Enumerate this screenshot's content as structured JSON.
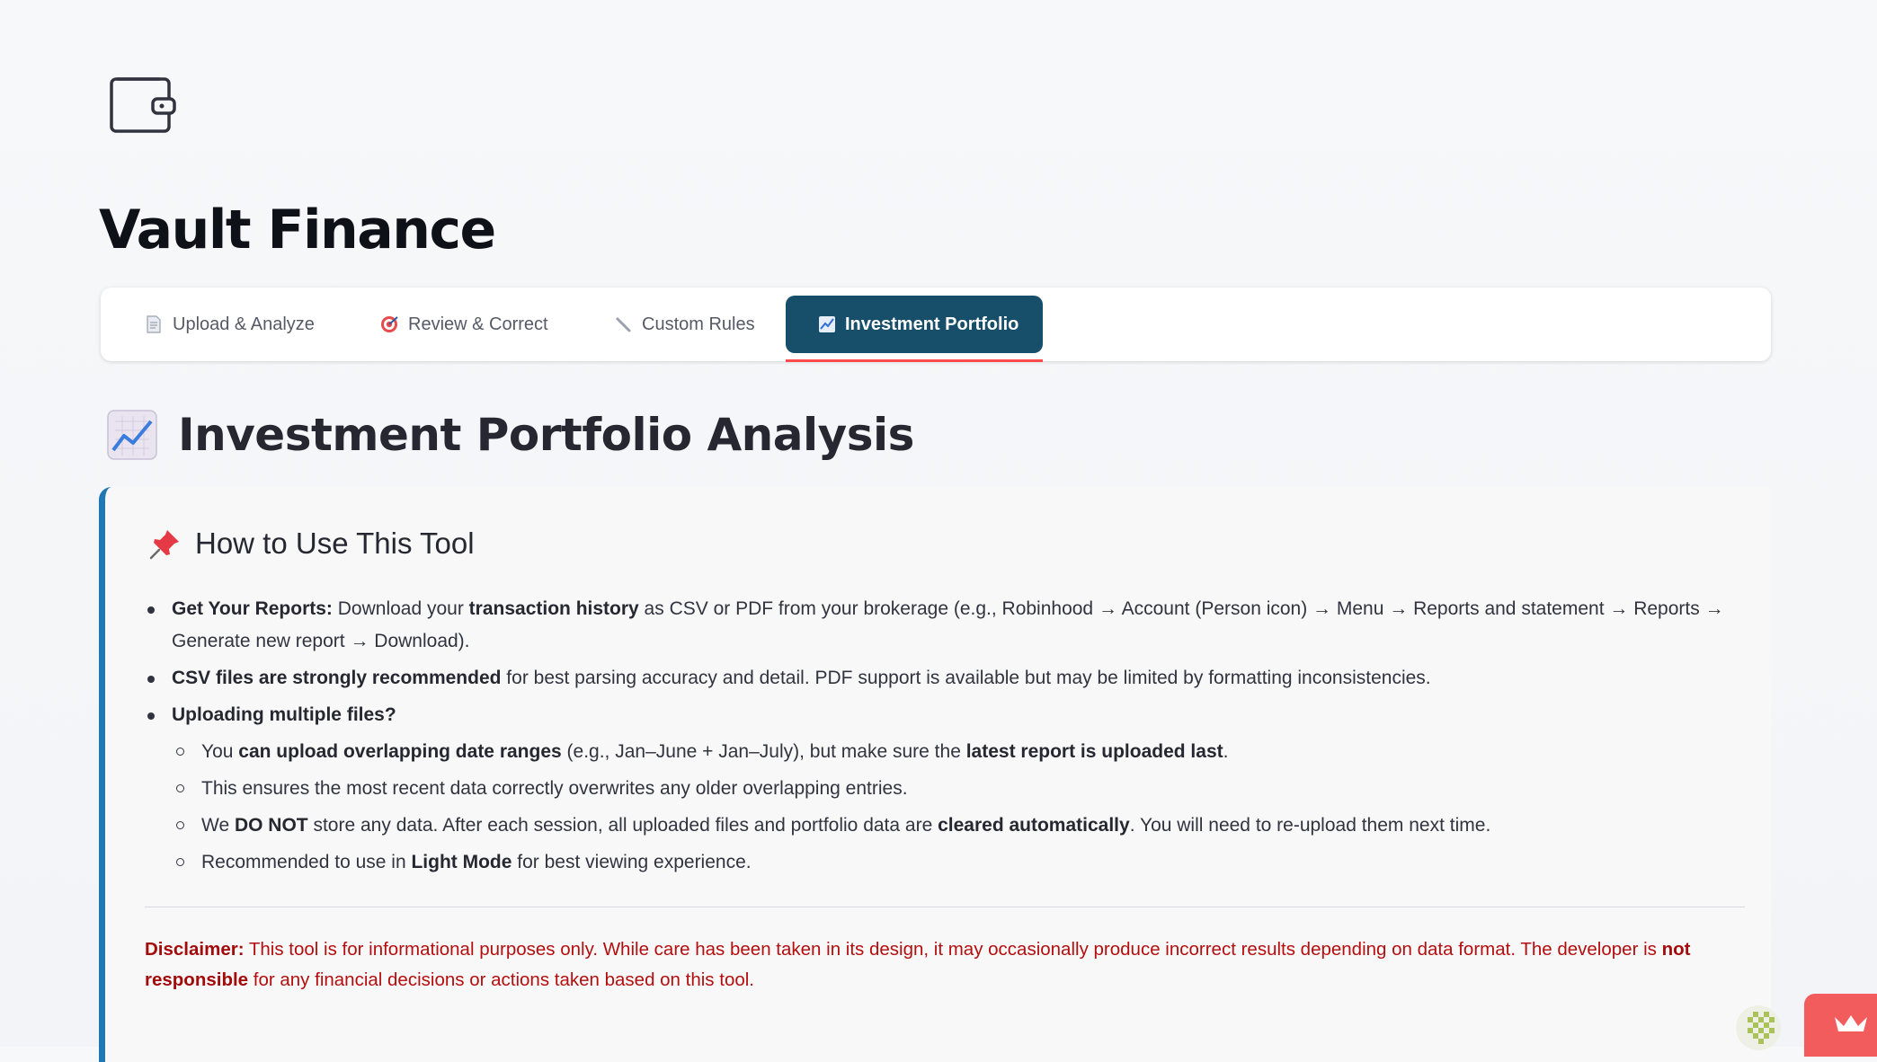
{
  "app": {
    "title": "Vault Finance",
    "logo": "wallet-icon"
  },
  "tabs": [
    {
      "label": "Upload & Analyze",
      "icon": "page-icon"
    },
    {
      "label": "Review & Correct",
      "icon": "target-icon"
    },
    {
      "label": "Custom Rules",
      "icon": "wrench-icon"
    },
    {
      "label": "Investment Portfolio",
      "icon": "chart-increasing-icon",
      "active": true
    }
  ],
  "page": {
    "title": "Investment Portfolio Analysis",
    "icon": "chart-increasing-icon"
  },
  "howto": {
    "title": "How to Use This Tool",
    "icon": "pushpin-icon",
    "b1": {
      "lead": "Get Your Reports:",
      "t1": " Download your ",
      "k1": "transaction history",
      "t2": " as CSV or PDF from your brokerage (e.g., Robinhood → Account (Person icon) → Menu → Reports and statement → Reports → Generate new report → Download)."
    },
    "b2": {
      "lead": "CSV files are strongly recommended",
      "t1": " for best parsing accuracy and detail. PDF support is available but may be limited by formatting inconsistencies."
    },
    "b3": {
      "lead": "Uploading multiple files?",
      "s1": {
        "t1": "You ",
        "k1": "can upload overlapping date ranges",
        "t2": " (e.g., Jan–June + Jan–July), but make sure the ",
        "k2": "latest report is uploaded last",
        "t3": "."
      },
      "s2": {
        "t1": "This ensures the most recent data correctly overwrites any older overlapping entries."
      },
      "s3": {
        "t1": "We ",
        "k1": "DO NOT",
        "t2": " store any data. After each session, all uploaded files and portfolio data are ",
        "k2": "cleared automatically",
        "t3": ". You will need to re-upload them next time."
      },
      "s4": {
        "t1": "Recommended to use in ",
        "k1": "Light Mode",
        "t2": " for best viewing experience."
      }
    }
  },
  "disclaimer": {
    "lead": "Disclaimer:",
    "t1": " This tool is for informational purposes only. While care has been taken in its design, it may occasionally produce incorrect results depending on data format. The developer is ",
    "k1": "not responsible",
    "t2": " for any financial decisions or actions taken based on this tool."
  },
  "colors": {
    "accent": "#174f6a",
    "border_left": "#1f77b4",
    "tab_underline": "#ff4b4b",
    "disclaimer": "#b40e0e",
    "corner_button": "#f25c5c"
  }
}
